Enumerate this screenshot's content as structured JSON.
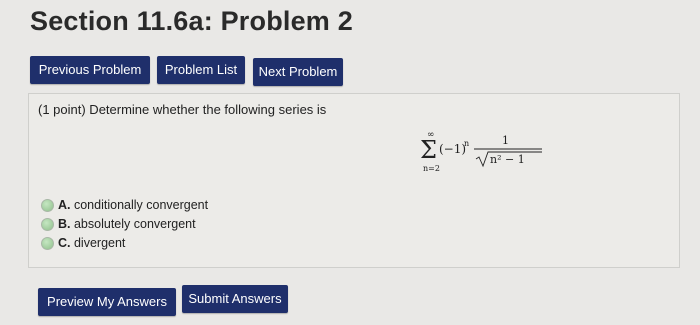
{
  "header": {
    "title": "Section 11.6a: Problem 2"
  },
  "nav": {
    "previous_label": "Previous Problem",
    "list_label": "Problem List",
    "next_label": "Next Problem"
  },
  "problem": {
    "prompt": "(1 point) Determine whether the following series is",
    "formula": {
      "upper_limit": "∞",
      "lower_limit": "n=2",
      "sigma": "Σ",
      "factor": "(−1)",
      "exponent": "n",
      "numerator": "1",
      "denominator_radicand": "n² − 1"
    },
    "choices": [
      {
        "letter": "A.",
        "text": "conditionally convergent"
      },
      {
        "letter": "B.",
        "text": "absolutely convergent"
      },
      {
        "letter": "C.",
        "text": "divergent"
      }
    ]
  },
  "actions": {
    "preview_label": "Preview My Answers",
    "submit_label": "Submit Answers"
  },
  "colors": {
    "button_bg": "#1f2f6b",
    "page_bg": "#e9e8e6",
    "radio": "#9cc999"
  }
}
